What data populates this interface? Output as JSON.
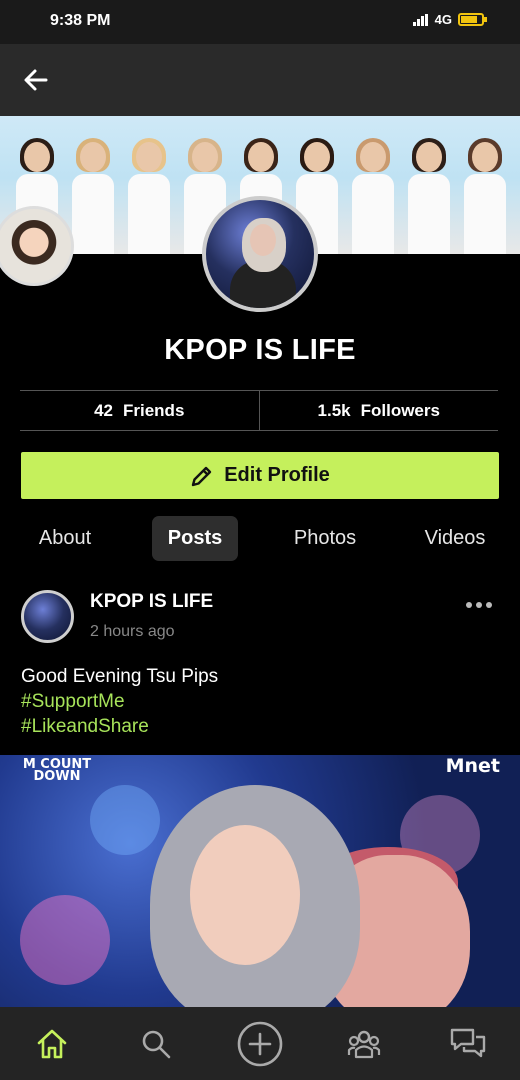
{
  "status_bar": {
    "time": "9:38 PM",
    "network": "4G",
    "battery_level": 0.8
  },
  "app_bar": {
    "back_icon": "arrow-left-icon"
  },
  "profile": {
    "name": "KPOP IS LIFE",
    "friends_count": "42",
    "friends_label": "Friends",
    "followers_count": "1.5k",
    "followers_label": "Followers",
    "edit_label": "Edit Profile",
    "edit_icon": "pencil-icon"
  },
  "tabs": [
    {
      "label": "About",
      "active": false
    },
    {
      "label": "Posts",
      "active": true
    },
    {
      "label": "Photos",
      "active": false
    },
    {
      "label": "Videos",
      "active": false
    }
  ],
  "post": {
    "author": "KPOP IS LIFE",
    "time": "2 hours ago",
    "text": "Good Evening Tsu Pips",
    "hashtags": [
      "#SupportMe",
      "#LikeandShare"
    ],
    "image_watermarks": [
      "M COUNT DOWN",
      "Mnet"
    ]
  },
  "bottom_nav": [
    {
      "icon": "home-icon",
      "active": true
    },
    {
      "icon": "search-icon",
      "active": false
    },
    {
      "icon": "add-circle-icon",
      "active": false
    },
    {
      "icon": "groups-icon",
      "active": false
    },
    {
      "icon": "chat-icon",
      "active": false
    }
  ],
  "colors": {
    "accent": "#c5f05c",
    "hashtag": "#a7e35a",
    "background": "#000000",
    "nav_background": "#242424"
  }
}
